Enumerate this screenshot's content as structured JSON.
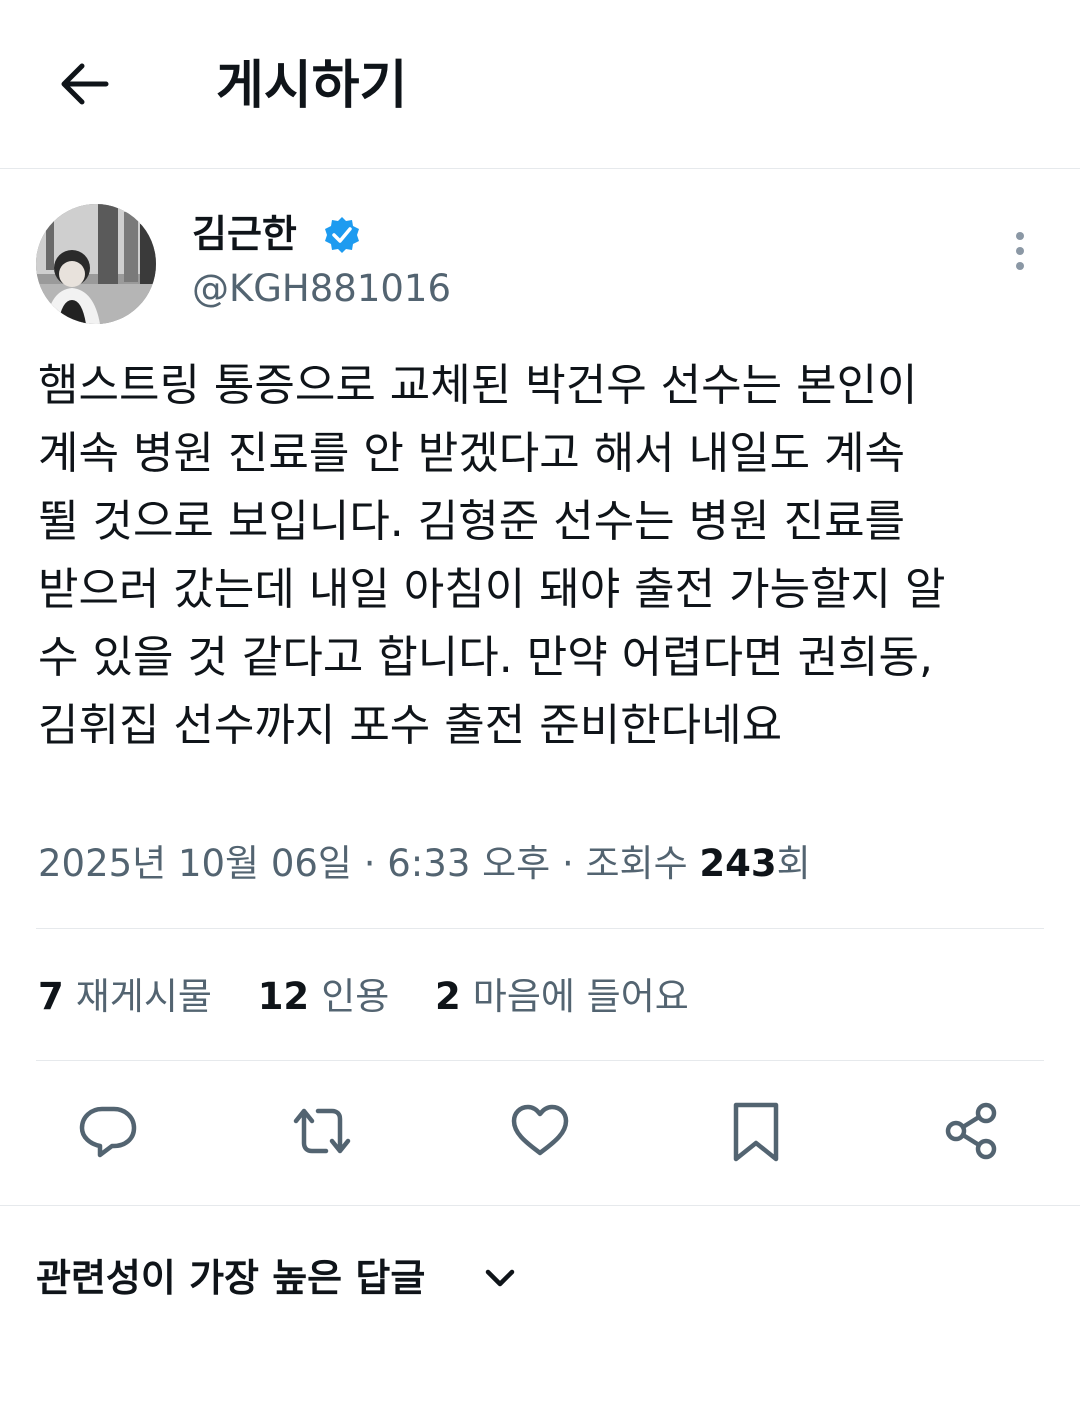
{
  "header": {
    "title": "게시하기",
    "back_icon": "back-arrow-icon"
  },
  "author": {
    "name": "김근한",
    "handle": "@KGH881016",
    "verified": true,
    "verified_color": "#1d9bf0"
  },
  "post": {
    "lines": [
      "햄스트링 통증으로 교체된 박건우 선수는 본인이",
      "계속 병원 진료를 안 받겠다고 해서 내일도 계속",
      "뛸 것으로 보입니다. 김형준 선수는 병원 진료를",
      "받으러 갔는데 내일 아침이 돼야 출전 가능할지 알",
      "수 있을 것 같다고 합니다. 만약 어렵다면 권희동,",
      "김휘집 선수까지 포수 출전 준비한다네요"
    ],
    "date": "2025년 10월 06일",
    "time": "6:33 오후",
    "separator": "·",
    "views_label": "조회수",
    "views_count": "243",
    "views_suffix": "회"
  },
  "stats": {
    "reposts": {
      "count": "7",
      "label": "재게시물"
    },
    "quotes": {
      "count": "12",
      "label": "인용"
    },
    "likes": {
      "count": "2",
      "label": "마음에 들어요"
    }
  },
  "actions": [
    {
      "name": "reply",
      "icon": "reply-icon"
    },
    {
      "name": "repost",
      "icon": "repost-icon"
    },
    {
      "name": "like",
      "icon": "heart-icon"
    },
    {
      "name": "bookmark",
      "icon": "bookmark-icon"
    },
    {
      "name": "share",
      "icon": "share-icon"
    }
  ],
  "replies_sort": {
    "label": "관련성이 가장 높은 답글",
    "icon": "chevron-down-icon"
  },
  "colors": {
    "text_primary": "#0f1419",
    "text_secondary": "#536471",
    "divider": "#e6e9ec",
    "icon": "#536471"
  }
}
